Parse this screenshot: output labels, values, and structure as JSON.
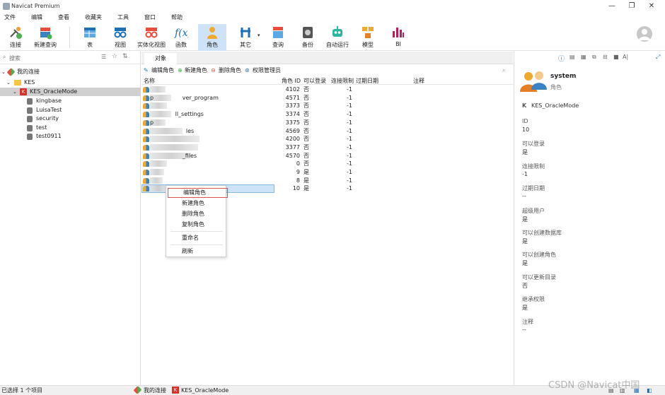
{
  "window": {
    "title": "Navicat Premium",
    "controls": [
      "—",
      "❐",
      "✕"
    ]
  },
  "menu": [
    "文件",
    "编辑",
    "查看",
    "收藏夹",
    "工具",
    "窗口",
    "帮助"
  ],
  "toolbar": {
    "items": [
      {
        "label": "连接",
        "icon": "connection-icon"
      },
      {
        "label": "新建查询",
        "icon": "new-query-icon"
      },
      {
        "label": "表",
        "icon": "table-icon"
      },
      {
        "label": "视图",
        "icon": "view-icon"
      },
      {
        "label": "实体化视图",
        "icon": "materialized-view-icon"
      },
      {
        "label": "函数",
        "icon": "function-icon"
      },
      {
        "label": "角色",
        "icon": "role-icon"
      },
      {
        "label": "其它",
        "icon": "other-icon"
      },
      {
        "label": "查询",
        "icon": "query-icon"
      },
      {
        "label": "备份",
        "icon": "backup-icon"
      },
      {
        "label": "自动运行",
        "icon": "automation-icon"
      },
      {
        "label": "模型",
        "icon": "model-icon"
      },
      {
        "label": "BI",
        "icon": "bi-icon"
      }
    ],
    "active": "角色"
  },
  "sidebar": {
    "search_placeholder": "搜索",
    "tree": {
      "root": "我的连接",
      "kes": "KES",
      "mode": "KES_OracleMode",
      "databases": [
        "kingbase",
        "LuisaTest",
        "security",
        "test",
        "test0911"
      ]
    }
  },
  "center": {
    "tab": "对象",
    "actions": {
      "edit": "编辑角色",
      "new": "新建角色",
      "delete": "删除角色",
      "privilege": "权限管理员"
    },
    "columns": {
      "name": "名称",
      "role_id": "角色 ID",
      "can_login": "可以登录",
      "conn_limit": "连接限制",
      "expire": "过期日期",
      "comment": "注释"
    },
    "rows": [
      {
        "name": "",
        "id": "4102",
        "login": "否",
        "limit": "-1"
      },
      {
        "name": "p                ver_program",
        "id": "4571",
        "login": "否",
        "limit": "-1"
      },
      {
        "name": "",
        "id": "3373",
        "login": "否",
        "limit": "-1"
      },
      {
        "name": "              ll_settings",
        "id": "3374",
        "login": "否",
        "limit": "-1"
      },
      {
        "name": "p",
        "id": "3375",
        "login": "否",
        "limit": "-1"
      },
      {
        "name": "                    les",
        "id": "4569",
        "login": "否",
        "limit": "-1"
      },
      {
        "name": "",
        "id": "4200",
        "login": "否",
        "limit": "-1"
      },
      {
        "name": "",
        "id": "3377",
        "login": "否",
        "limit": "-1"
      },
      {
        "name": "                  _files",
        "id": "4570",
        "login": "否",
        "limit": "-1"
      },
      {
        "name": "",
        "id": "0",
        "login": "否",
        "limit": "-1"
      },
      {
        "name": "",
        "id": "9",
        "login": "是",
        "limit": "-1"
      },
      {
        "name": "",
        "id": "8",
        "login": "是",
        "limit": "-1"
      },
      {
        "name": "",
        "id": "10",
        "login": "是",
        "limit": "-1"
      }
    ]
  },
  "context_menu": {
    "items": [
      "编辑角色",
      "新建角色",
      "删除角色",
      "复制角色",
      "重命名",
      "刷新"
    ]
  },
  "details": {
    "name": "system",
    "type": "角色",
    "schema": "KES_OracleMode",
    "fields": [
      {
        "label": "ID",
        "value": "10"
      },
      {
        "label": "可以登录",
        "value": "是"
      },
      {
        "label": "连接限制",
        "value": "-1"
      },
      {
        "label": "过期日期",
        "value": "--"
      },
      {
        "label": "超级用户",
        "value": "是"
      },
      {
        "label": "可以创建数据库",
        "value": "是"
      },
      {
        "label": "可以创建角色",
        "value": "是"
      },
      {
        "label": "可以更新目录",
        "value": "否"
      },
      {
        "label": "继承权限",
        "value": "是"
      },
      {
        "label": "注释",
        "value": "--"
      }
    ]
  },
  "status": {
    "selection": "已选择 1 个项目",
    "connection": "我的连接",
    "schema": "KES_OracleMode"
  },
  "watermark": "CSDN @Navicat中国",
  "colors": {
    "accent": "#cfe3f8",
    "highlight_box": "#e05252",
    "kes_red": "#d9302c"
  }
}
